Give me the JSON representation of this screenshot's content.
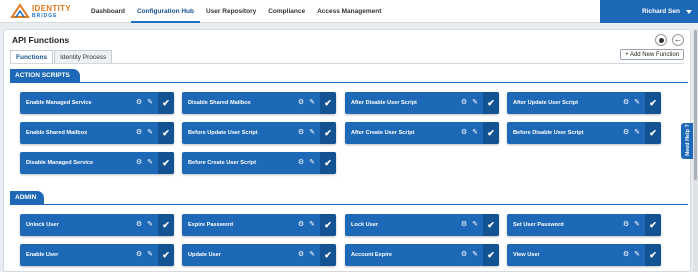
{
  "logo": {
    "line1": "IDENTITY",
    "line2": "BRIDGE"
  },
  "nav": [
    {
      "label": "Dashboard"
    },
    {
      "label": "Configuration Hub"
    },
    {
      "label": "User Repository"
    },
    {
      "label": "Compliance"
    },
    {
      "label": "Access Management"
    }
  ],
  "user": {
    "name": "Richard Sen"
  },
  "page": {
    "title": "API Functions",
    "back_glyph": "←"
  },
  "tabs": [
    {
      "label": "Functions"
    },
    {
      "label": "Identity Process"
    }
  ],
  "add_button": "+ Add New Function",
  "sections": [
    {
      "title": "ACTION SCRIPTS",
      "cards": [
        "Enable Managed Service",
        "Disable Shared Mailbox",
        "After Disable User Script",
        "After Update User Script",
        "Enable Shared Mailbox",
        "Before Update User Script",
        "After Create User Script",
        "Before Disable User Script",
        "Disable Managed Service",
        "Before Create User Script"
      ]
    },
    {
      "title": "ADMIN",
      "cards": [
        "Unlock User",
        "Expire Password",
        "Lock User",
        "Set User Password",
        "Enable User",
        "Update User",
        "Account Expire",
        "View User"
      ]
    }
  ],
  "card_icons": {
    "gear": "⚙",
    "pencil": "✎",
    "check": "✔"
  },
  "need_help": "Need Help ?",
  "colors": {
    "primary": "#1e69b7",
    "check_bg": "#145393",
    "logo_orange": "#e07a1f"
  }
}
